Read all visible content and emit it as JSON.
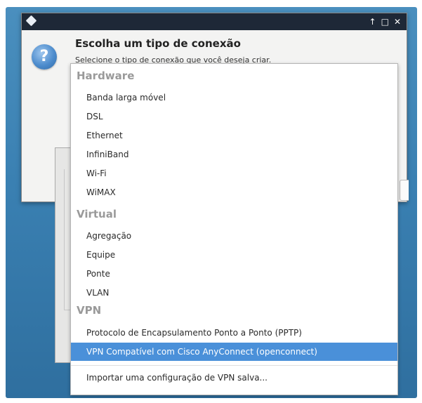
{
  "window": {
    "controls": [
      "↑",
      "□",
      "✕"
    ]
  },
  "dialog": {
    "icon": "question-icon",
    "icon_glyph": "?",
    "title": "Escolha um tipo de conexão",
    "subtitle": "Selecione o tipo de conexão que você deseja criar."
  },
  "menu": {
    "hardware_header": "Hardware",
    "hardware_items": [
      "Banda larga móvel",
      "DSL",
      "Ethernet",
      "InfiniBand",
      "Wi-Fi",
      "WiMAX"
    ],
    "virtual_header": "Virtual",
    "virtual_items": [
      "Agregação",
      "Equipe",
      "Ponte",
      "VLAN"
    ],
    "vpn_header": "VPN",
    "vpn_items": [
      "Protocolo de Encapsulamento Ponto a Ponto (PPTP)",
      "VPN Compatível com Cisco AnyConnect (openconnect)"
    ],
    "selected_item": "VPN Compatível com Cisco AnyConnect (openconnect)",
    "import_item": "Importar uma configuração de VPN salva..."
  },
  "colors": {
    "titlebar": "#1e2837",
    "selection": "#4a90d9",
    "desktop": "#3a80b2"
  }
}
